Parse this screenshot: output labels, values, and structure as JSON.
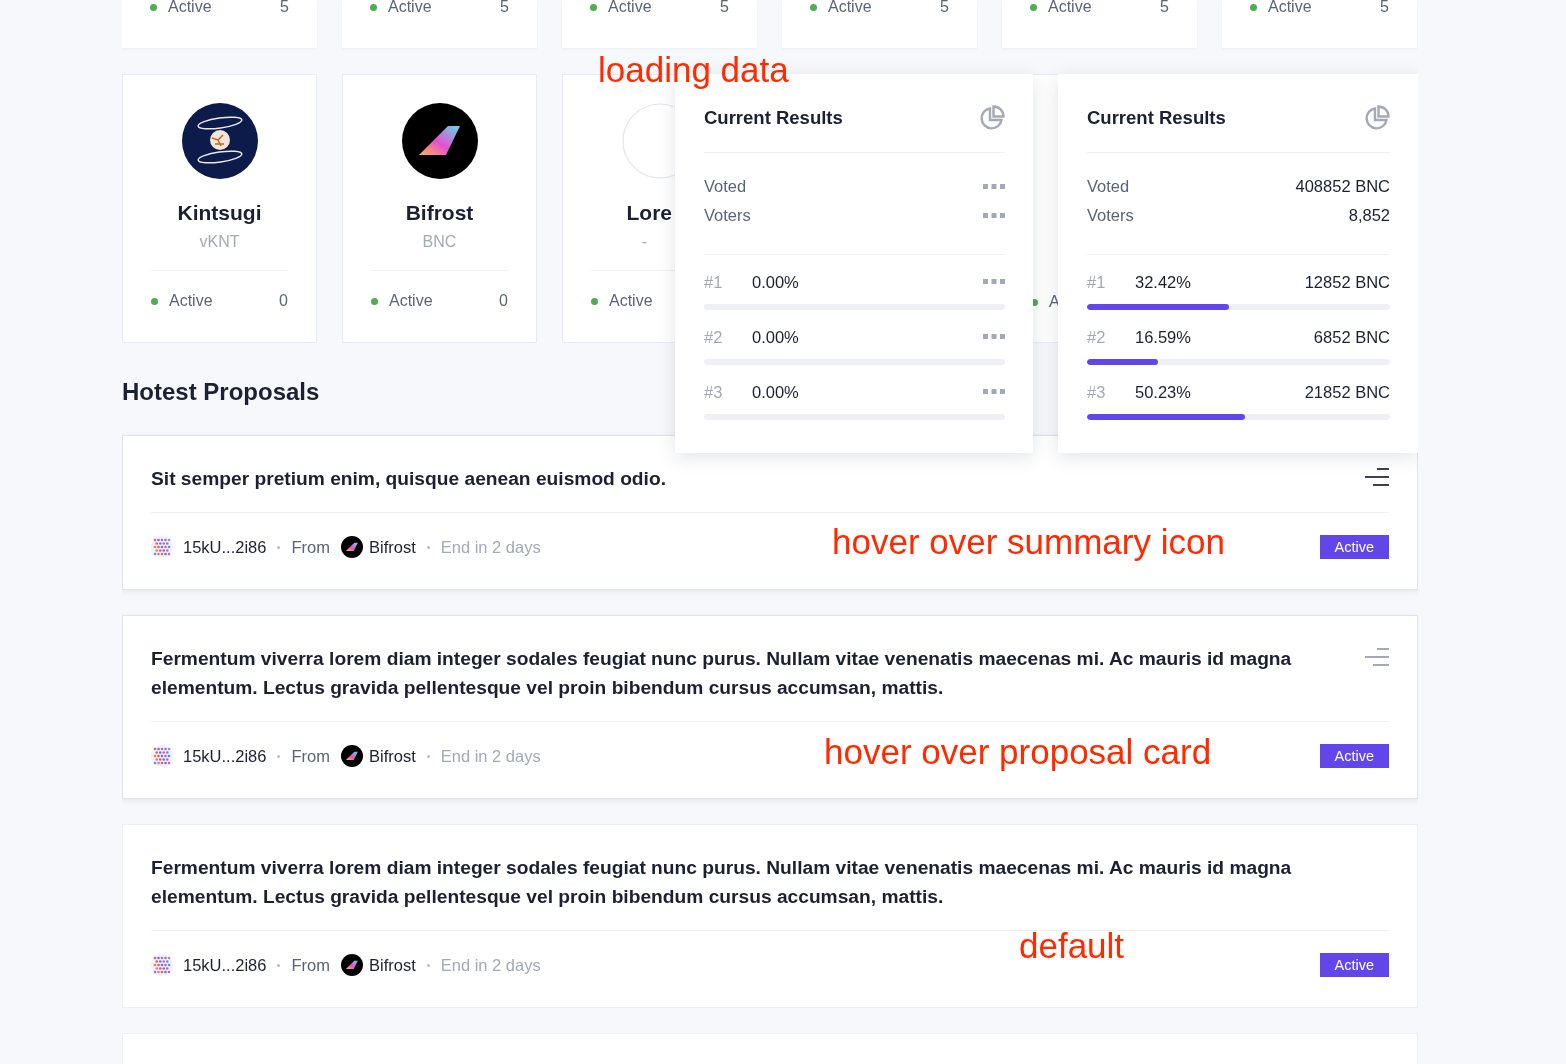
{
  "top_cards": [
    {
      "status": "Active",
      "count": "5"
    },
    {
      "status": "Active",
      "count": "5"
    },
    {
      "status": "Active",
      "count": "5"
    },
    {
      "status": "Active",
      "count": "5"
    },
    {
      "status": "Active",
      "count": "5"
    },
    {
      "status": "Active",
      "count": "5"
    }
  ],
  "spaces": [
    {
      "kind": "kintsugi",
      "name": "Kintsugi",
      "symbol": "vKNT",
      "status": "Active",
      "count": "0"
    },
    {
      "kind": "bifrost",
      "name": "Bifrost",
      "symbol": "BNC",
      "status": "Active",
      "count": "0"
    },
    {
      "kind": "empty",
      "name": "Lore",
      "symbol": "-",
      "status": "Active"
    }
  ],
  "partial_space": {
    "status": "A"
  },
  "popovers": [
    {
      "annotation": "loading data",
      "title": "Current Results",
      "loading": true,
      "stats": [
        {
          "label": "Voted"
        },
        {
          "label": "Voters"
        }
      ],
      "options": [
        {
          "rank": "#1",
          "percent": "0.00%"
        },
        {
          "rank": "#2",
          "percent": "0.00%"
        },
        {
          "rank": "#3",
          "percent": "0.00%"
        }
      ]
    },
    {
      "title": "Current Results",
      "loading": false,
      "stats": [
        {
          "label": "Voted",
          "value": "408852 BNC"
        },
        {
          "label": "Voters",
          "value": "8,852"
        }
      ],
      "options": [
        {
          "rank": "#1",
          "percent": "32.42%",
          "amount": "12852 BNC",
          "level": 0.47
        },
        {
          "rank": "#2",
          "percent": "16.59%",
          "amount": "6852 BNC",
          "level": 0.235
        },
        {
          "rank": "#3",
          "percent": "50.23%",
          "amount": "21852 BNC",
          "level": 0.52
        }
      ]
    }
  ],
  "section_title": "Hotest Proposals",
  "proposals": [
    {
      "title": "Sit semper pretium enim, quisque aenean euismod odio.",
      "hovered": true,
      "icon_hovered": true,
      "address": "15kU...2i86",
      "from_label": "From",
      "space": "Bifrost",
      "end": "End in 2 days",
      "status": "Active",
      "annotation": "hover over summary icon"
    },
    {
      "title": "Fermentum viverra lorem diam integer sodales feugiat nunc purus. Nullam vitae venenatis maecenas mi. Ac mauris id magna elementum. Lectus gravida pellentesque vel proin bibendum cursus accumsan, mattis.",
      "hovered": true,
      "icon_hovered": false,
      "address": "15kU...2i86",
      "from_label": "From",
      "space": "Bifrost",
      "end": "End in 2 days",
      "status": "Active",
      "annotation": "hover over proposal card"
    },
    {
      "title": "Fermentum viverra lorem diam integer sodales feugiat nunc purus. Nullam vitae venenatis maecenas mi. Ac mauris id magna elementum. Lectus gravida pellentesque vel proin bibendum cursus accumsan, mattis.",
      "hovered": false,
      "address": "15kU...2i86",
      "from_label": "From",
      "space": "Bifrost",
      "end": "End in 2 days",
      "status": "Active",
      "annotation": "default"
    }
  ]
}
